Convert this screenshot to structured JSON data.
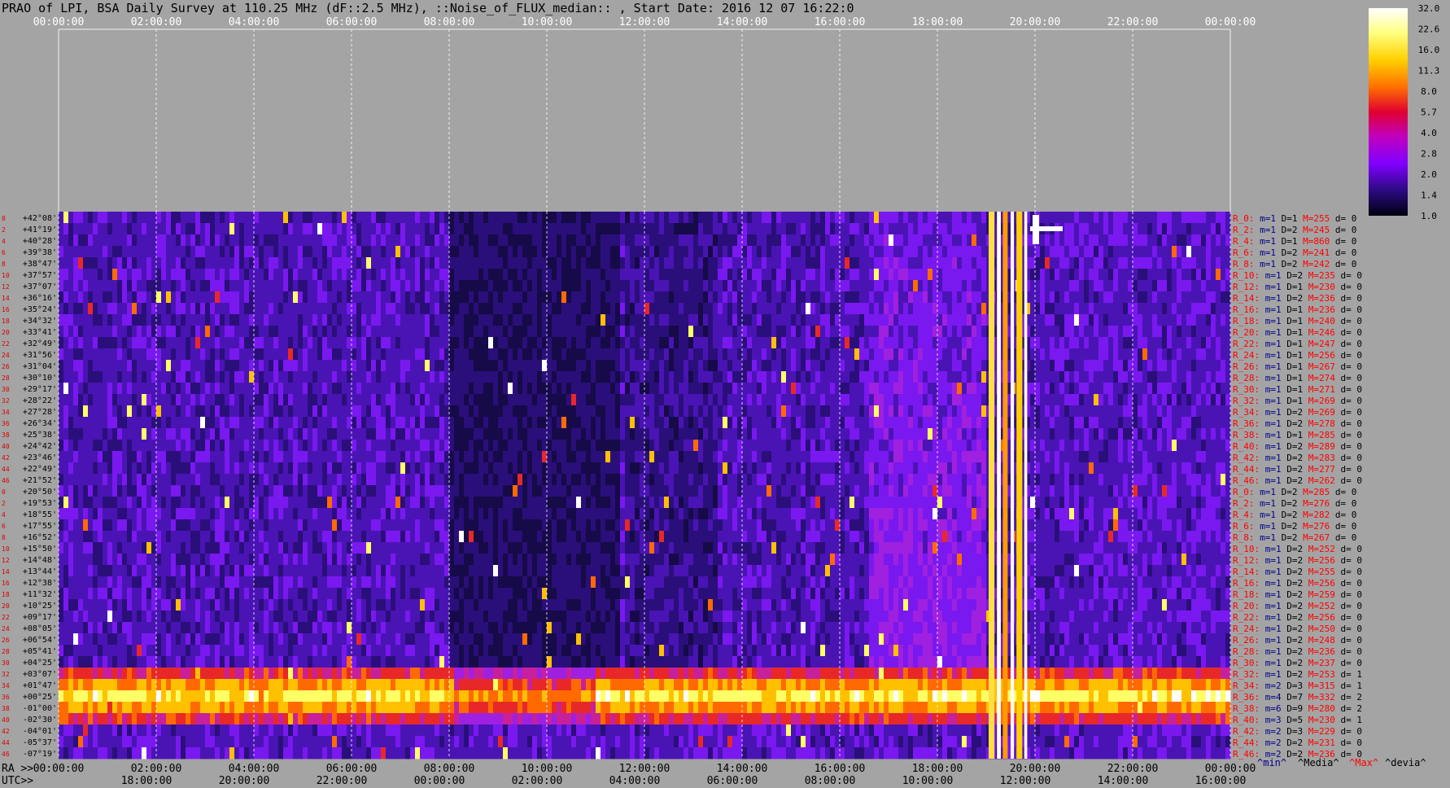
{
  "title": "PRAO of LPI, BSA Daily Survey at 110.25 MHz (dF::2.5 MHz), ::Noise_of_FLUX_median:: , Start Date: 2016 12 07 16:22:0",
  "axes": {
    "top_ticks": [
      "00:00:00",
      "02:00:00",
      "04:00:00",
      "06:00:00",
      "08:00:00",
      "10:00:00",
      "12:00:00",
      "14:00:00",
      "16:00:00",
      "18:00:00",
      "20:00:00",
      "22:00:00",
      "00:00:00"
    ],
    "ra_label": "RA >>",
    "ra_ticks": [
      "00:00:00",
      "02:00:00",
      "04:00:00",
      "06:00:00",
      "08:00:00",
      "10:00:00",
      "12:00:00",
      "14:00:00",
      "16:00:00",
      "18:00:00",
      "20:00:00",
      "22:00:00",
      "00:00:00"
    ],
    "utc_label": "UTC>>",
    "utc_ticks": [
      "18:00:00",
      "20:00:00",
      "22:00:00",
      "00:00:00",
      "02:00:00",
      "04:00:00",
      "06:00:00",
      "08:00:00",
      "10:00:00",
      "12:00:00",
      "14:00:00",
      "16:00:00"
    ]
  },
  "declinations": [
    "+42°08'",
    "+41°19'",
    "+40°28'",
    "+39°38'",
    "+38°47'",
    "+37°57'",
    "+37°07'",
    "+36°16'",
    "+35°24'",
    "+34°32'",
    "+33°41'",
    "+32°49'",
    "+31°56'",
    "+31°04'",
    "+30°10'",
    "+29°17'",
    "+28°22'",
    "+27°28'",
    "+26°34'",
    "+25°38'",
    "+24°42'",
    "+23°46'",
    "+22°49'",
    "+21°52'",
    "+20°50'",
    "+19°53'",
    "+18°55'",
    "+17°55'",
    "+16°52'",
    "+15°50'",
    "+14°48'",
    "+13°44'",
    "+12°38'",
    "+11°32'",
    "+10°25'",
    "+09°17'",
    "+08°05'",
    "+06°54'",
    "+05°41'",
    "+04°25'",
    "+03°07'",
    "+01°47'",
    "+00°25'",
    "-01°00'",
    "-02°30'",
    "-04°01'",
    "-05°37'",
    "-07°19'"
  ],
  "row_numbers": [
    "0",
    "2",
    "4",
    "6",
    "8",
    "10",
    "12",
    "14",
    "16",
    "18",
    "20",
    "22",
    "24",
    "26",
    "28",
    "30",
    "32",
    "34",
    "36",
    "38",
    "40",
    "42",
    "44",
    "46",
    "0",
    "2",
    "4",
    "6",
    "8",
    "10",
    "12",
    "14",
    "16",
    "18",
    "20",
    "22",
    "24",
    "26",
    "28",
    "30",
    "32",
    "34",
    "36",
    "38",
    "40",
    "42",
    "44",
    "46"
  ],
  "stats": [
    {
      "r": "R_0:",
      "m": "m=1",
      "D": "D=1",
      "M": "M=255",
      "d": "d= 0"
    },
    {
      "r": "R_2:",
      "m": "m=1",
      "D": "D=2",
      "M": "M=245",
      "d": "d= 0"
    },
    {
      "r": "R_4:",
      "m": "m=1",
      "D": "D=1",
      "M": "M=860",
      "d": "d= 0"
    },
    {
      "r": "R_6:",
      "m": "m=1",
      "D": "D=2",
      "M": "M=241",
      "d": "d= 0"
    },
    {
      "r": "R_8:",
      "m": "m=1",
      "D": "D=2",
      "M": "M=242",
      "d": "d= 0"
    },
    {
      "r": "R_10:",
      "m": "m=1",
      "D": "D=2",
      "M": "M=235",
      "d": "d= 0"
    },
    {
      "r": "R_12:",
      "m": "m=1",
      "D": "D=1",
      "M": "M=230",
      "d": "d= 0"
    },
    {
      "r": "R_14:",
      "m": "m=1",
      "D": "D=2",
      "M": "M=236",
      "d": "d= 0"
    },
    {
      "r": "R_16:",
      "m": "m=1",
      "D": "D=1",
      "M": "M=236",
      "d": "d= 0"
    },
    {
      "r": "R_18:",
      "m": "m=1",
      "D": "D=1",
      "M": "M=240",
      "d": "d= 0"
    },
    {
      "r": "R_20:",
      "m": "m=1",
      "D": "D=1",
      "M": "M=246",
      "d": "d= 0"
    },
    {
      "r": "R_22:",
      "m": "m=1",
      "D": "D=1",
      "M": "M=247",
      "d": "d= 0"
    },
    {
      "r": "R_24:",
      "m": "m=1",
      "D": "D=1",
      "M": "M=256",
      "d": "d= 0"
    },
    {
      "r": "R_26:",
      "m": "m=1",
      "D": "D=1",
      "M": "M=267",
      "d": "d= 0"
    },
    {
      "r": "R_28:",
      "m": "m=1",
      "D": "D=1",
      "M": "M=274",
      "d": "d= 0"
    },
    {
      "r": "R_30:",
      "m": "m=1",
      "D": "D=1",
      "M": "M=271",
      "d": "d= 0"
    },
    {
      "r": "R_32:",
      "m": "m=1",
      "D": "D=1",
      "M": "M=269",
      "d": "d= 0"
    },
    {
      "r": "R_34:",
      "m": "m=1",
      "D": "D=2",
      "M": "M=269",
      "d": "d= 0"
    },
    {
      "r": "R_36:",
      "m": "m=1",
      "D": "D=2",
      "M": "M=278",
      "d": "d= 0"
    },
    {
      "r": "R_38:",
      "m": "m=1",
      "D": "D=1",
      "M": "M=285",
      "d": "d= 0"
    },
    {
      "r": "R_40:",
      "m": "m=1",
      "D": "D=2",
      "M": "M=289",
      "d": "d= 0"
    },
    {
      "r": "R_42:",
      "m": "m=1",
      "D": "D=2",
      "M": "M=283",
      "d": "d= 0"
    },
    {
      "r": "R_44:",
      "m": "m=1",
      "D": "D=2",
      "M": "M=277",
      "d": "d= 0"
    },
    {
      "r": "R_46:",
      "m": "m=1",
      "D": "D=2",
      "M": "M=262",
      "d": "d= 0"
    },
    {
      "r": "R_0:",
      "m": "m=1",
      "D": "D=2",
      "M": "M=285",
      "d": "d= 0"
    },
    {
      "r": "R_2:",
      "m": "m=1",
      "D": "D=2",
      "M": "M=276",
      "d": "d= 0"
    },
    {
      "r": "R_4:",
      "m": "m=1",
      "D": "D=2",
      "M": "M=282",
      "d": "d= 0"
    },
    {
      "r": "R_6:",
      "m": "m=1",
      "D": "D=2",
      "M": "M=276",
      "d": "d= 0"
    },
    {
      "r": "R_8:",
      "m": "m=1",
      "D": "D=2",
      "M": "M=267",
      "d": "d= 0"
    },
    {
      "r": "R_10:",
      "m": "m=1",
      "D": "D=2",
      "M": "M=252",
      "d": "d= 0"
    },
    {
      "r": "R_12:",
      "m": "m=1",
      "D": "D=2",
      "M": "M=256",
      "d": "d= 0"
    },
    {
      "r": "R_14:",
      "m": "m=1",
      "D": "D=2",
      "M": "M=255",
      "d": "d= 0"
    },
    {
      "r": "R_16:",
      "m": "m=1",
      "D": "D=2",
      "M": "M=256",
      "d": "d= 0"
    },
    {
      "r": "R_18:",
      "m": "m=1",
      "D": "D=2",
      "M": "M=259",
      "d": "d= 0"
    },
    {
      "r": "R_20:",
      "m": "m=1",
      "D": "D=2",
      "M": "M=252",
      "d": "d= 0"
    },
    {
      "r": "R_22:",
      "m": "m=1",
      "D": "D=2",
      "M": "M=256",
      "d": "d= 0"
    },
    {
      "r": "R_24:",
      "m": "m=1",
      "D": "D=2",
      "M": "M=250",
      "d": "d= 0"
    },
    {
      "r": "R_26:",
      "m": "m=1",
      "D": "D=2",
      "M": "M=248",
      "d": "d= 0"
    },
    {
      "r": "R_28:",
      "m": "m=1",
      "D": "D=2",
      "M": "M=236",
      "d": "d= 0"
    },
    {
      "r": "R_30:",
      "m": "m=1",
      "D": "D=2",
      "M": "M=237",
      "d": "d= 0"
    },
    {
      "r": "R_32:",
      "m": "m=1",
      "D": "D=2",
      "M": "M=253",
      "d": "d= 1"
    },
    {
      "r": "R_34:",
      "m": "m=2",
      "D": "D=3",
      "M": "M=315",
      "d": "d= 1"
    },
    {
      "r": "R_36:",
      "m": "m=4",
      "D": "D=7",
      "M": "M=332",
      "d": "d= 2"
    },
    {
      "r": "R_38:",
      "m": "m=6",
      "D": "D=9",
      "M": "M=280",
      "d": "d= 2"
    },
    {
      "r": "R_40:",
      "m": "m=3",
      "D": "D=5",
      "M": "M=230",
      "d": "d= 1"
    },
    {
      "r": "R_42:",
      "m": "m=2",
      "D": "D=3",
      "M": "M=229",
      "d": "d= 0"
    },
    {
      "r": "R_44:",
      "m": "m=2",
      "D": "D=2",
      "M": "M=231",
      "d": "d= 0"
    },
    {
      "r": "R_46:",
      "m": "m=2",
      "D": "D=2",
      "M": "M=236",
      "d": "d= 0"
    }
  ],
  "legend": {
    "min": "^min^",
    "media": "^Media^",
    "max": "^Max^",
    "devia": "^devia^"
  },
  "colorbar": {
    "ticks": [
      "32.0",
      "22.6",
      "16.0",
      "11.3",
      "8.0",
      "5.7",
      "4.0",
      "2.8",
      "2.0",
      "1.4",
      "1.0"
    ]
  },
  "colors": {
    "background": "#a4a4a4",
    "min": "#00008b",
    "media": "#000000",
    "max": "#ff0000",
    "devia": "#000000"
  },
  "chart_data": {
    "type": "heatmap",
    "title": "PRAO of LPI, BSA Daily Survey at 110.25 MHz (dF::2.5 MHz), ::Noise_of_FLUX_median:: , Start Date: 2016 12 07 16:22:0",
    "xlabel": "RA >>",
    "x_range": [
      "00:00:00",
      "24:00:00"
    ],
    "secondary_x": "UTC>>",
    "y_range": [
      "+42°08'",
      "-07°19'"
    ],
    "colorscale": "log",
    "zlim": [
      1.0,
      32.0
    ],
    "features": [
      {
        "kind": "bright band",
        "dec_from": "+03°07'",
        "dec_to": "-02°30'",
        "ra_from": "00:00:00",
        "ra_to": "24:00:00"
      },
      {
        "kind": "saturated vertical stripe",
        "ra_from": "19:05:00",
        "ra_to": "19:50:00"
      },
      {
        "kind": "bright source",
        "ra": "20:00:00",
        "dec": "+40°28'"
      }
    ]
  }
}
